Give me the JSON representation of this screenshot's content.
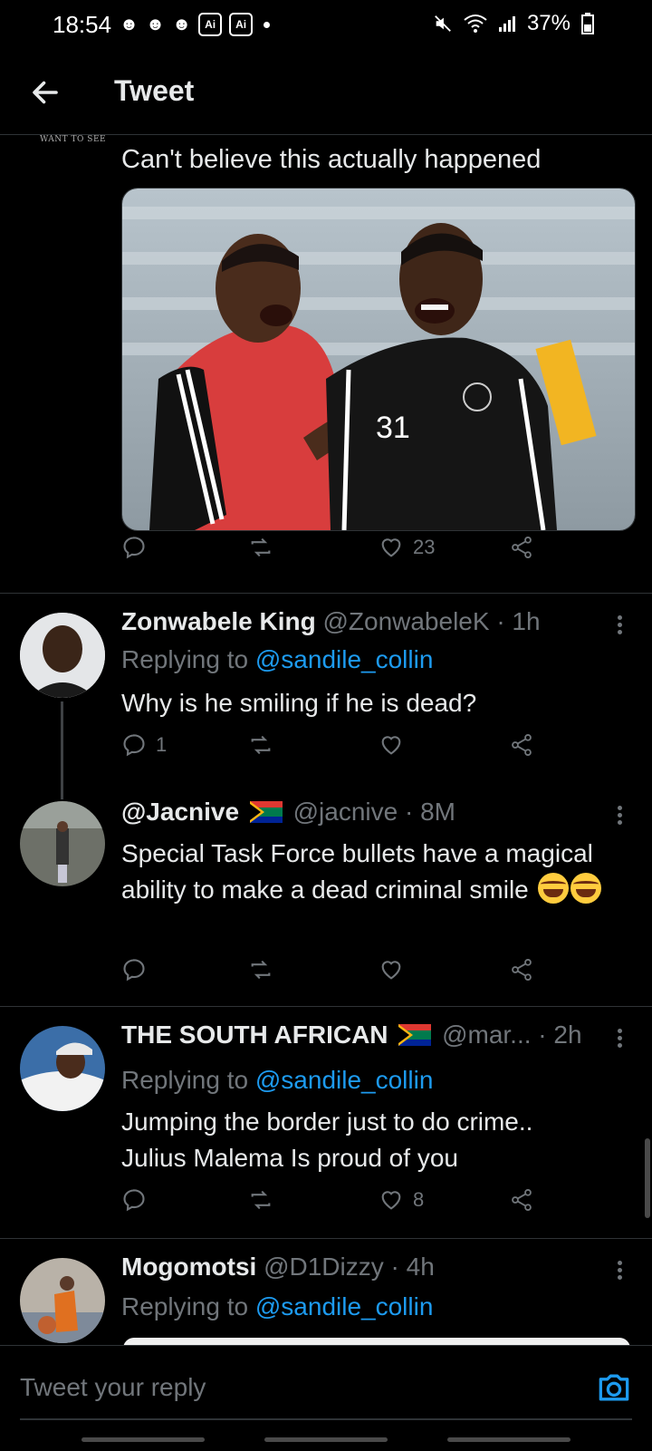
{
  "status_bar": {
    "time": "18:54",
    "battery": "37%"
  },
  "header": {
    "title": "Tweet"
  },
  "original_tweet": {
    "clip_label": "WANT TO SEE",
    "text": "Can't believe this actually happened",
    "likes": "23"
  },
  "replies": [
    {
      "name": "Zonwabele King",
      "handle": "@ZonwabeleK",
      "time": "· 1h",
      "replying_to_label": "Replying to",
      "replying_to": "@sandile_collin",
      "text": "Why is he smiling if he is dead?",
      "reply_count": "1",
      "likes": ""
    },
    {
      "name": "@Jacnive",
      "handle": "@jacnive",
      "time": "· 8M",
      "text": "Special Task Force bullets have a magical ability to make a dead criminal smile",
      "reply_count": "",
      "likes": ""
    },
    {
      "name": "THE SOUTH AFRICAN",
      "handle": "@mar...",
      "time": "· 2h",
      "replying_to_label": "Replying to",
      "replying_to": "@sandile_collin",
      "text_line1": "Jumping the border just to do crime..",
      "text_line2": "Julius Malema Is proud of you",
      "likes": "8"
    },
    {
      "name": "Mogomotsi",
      "handle": "@D1Dizzy",
      "time": "· 4h",
      "replying_to_label": "Replying to",
      "replying_to": "@sandile_collin"
    }
  ],
  "compose": {
    "placeholder": "Tweet your reply"
  },
  "colors": {
    "background": "#000000",
    "accent": "#1d9bf0",
    "muted": "#71767b",
    "text": "#e7e9ea"
  }
}
